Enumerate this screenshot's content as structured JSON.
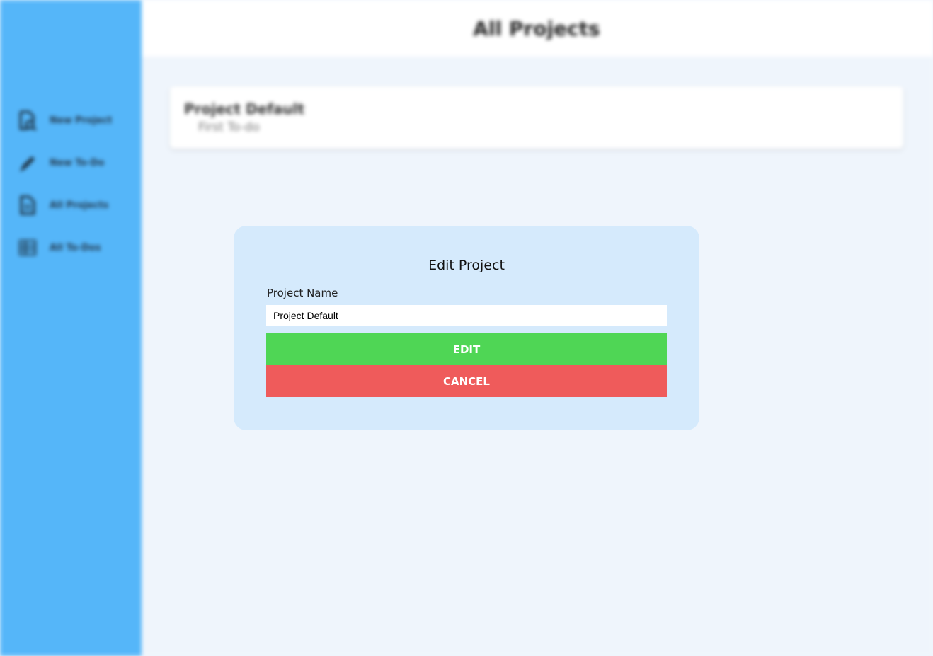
{
  "header": {
    "title": "All Projects"
  },
  "sidebar": {
    "items": [
      {
        "label": "New Project",
        "icon": "new-project-icon"
      },
      {
        "label": "New To-Do",
        "icon": "pencil-icon"
      },
      {
        "label": "All Projects",
        "icon": "document-icon"
      },
      {
        "label": "All To-Dos",
        "icon": "list-icon"
      }
    ]
  },
  "projects": [
    {
      "title": "Project Default",
      "todo": "First To-do"
    }
  ],
  "modal": {
    "title": "Edit Project",
    "field_label": "Project Name",
    "input_value": "Project Default",
    "edit_label": "EDIT",
    "cancel_label": "CANCEL"
  },
  "colors": {
    "sidebar": "#55b6f9",
    "modal_bg": "#d5eafc",
    "edit_button": "#4fd655",
    "cancel_button": "#ef5b5b"
  }
}
